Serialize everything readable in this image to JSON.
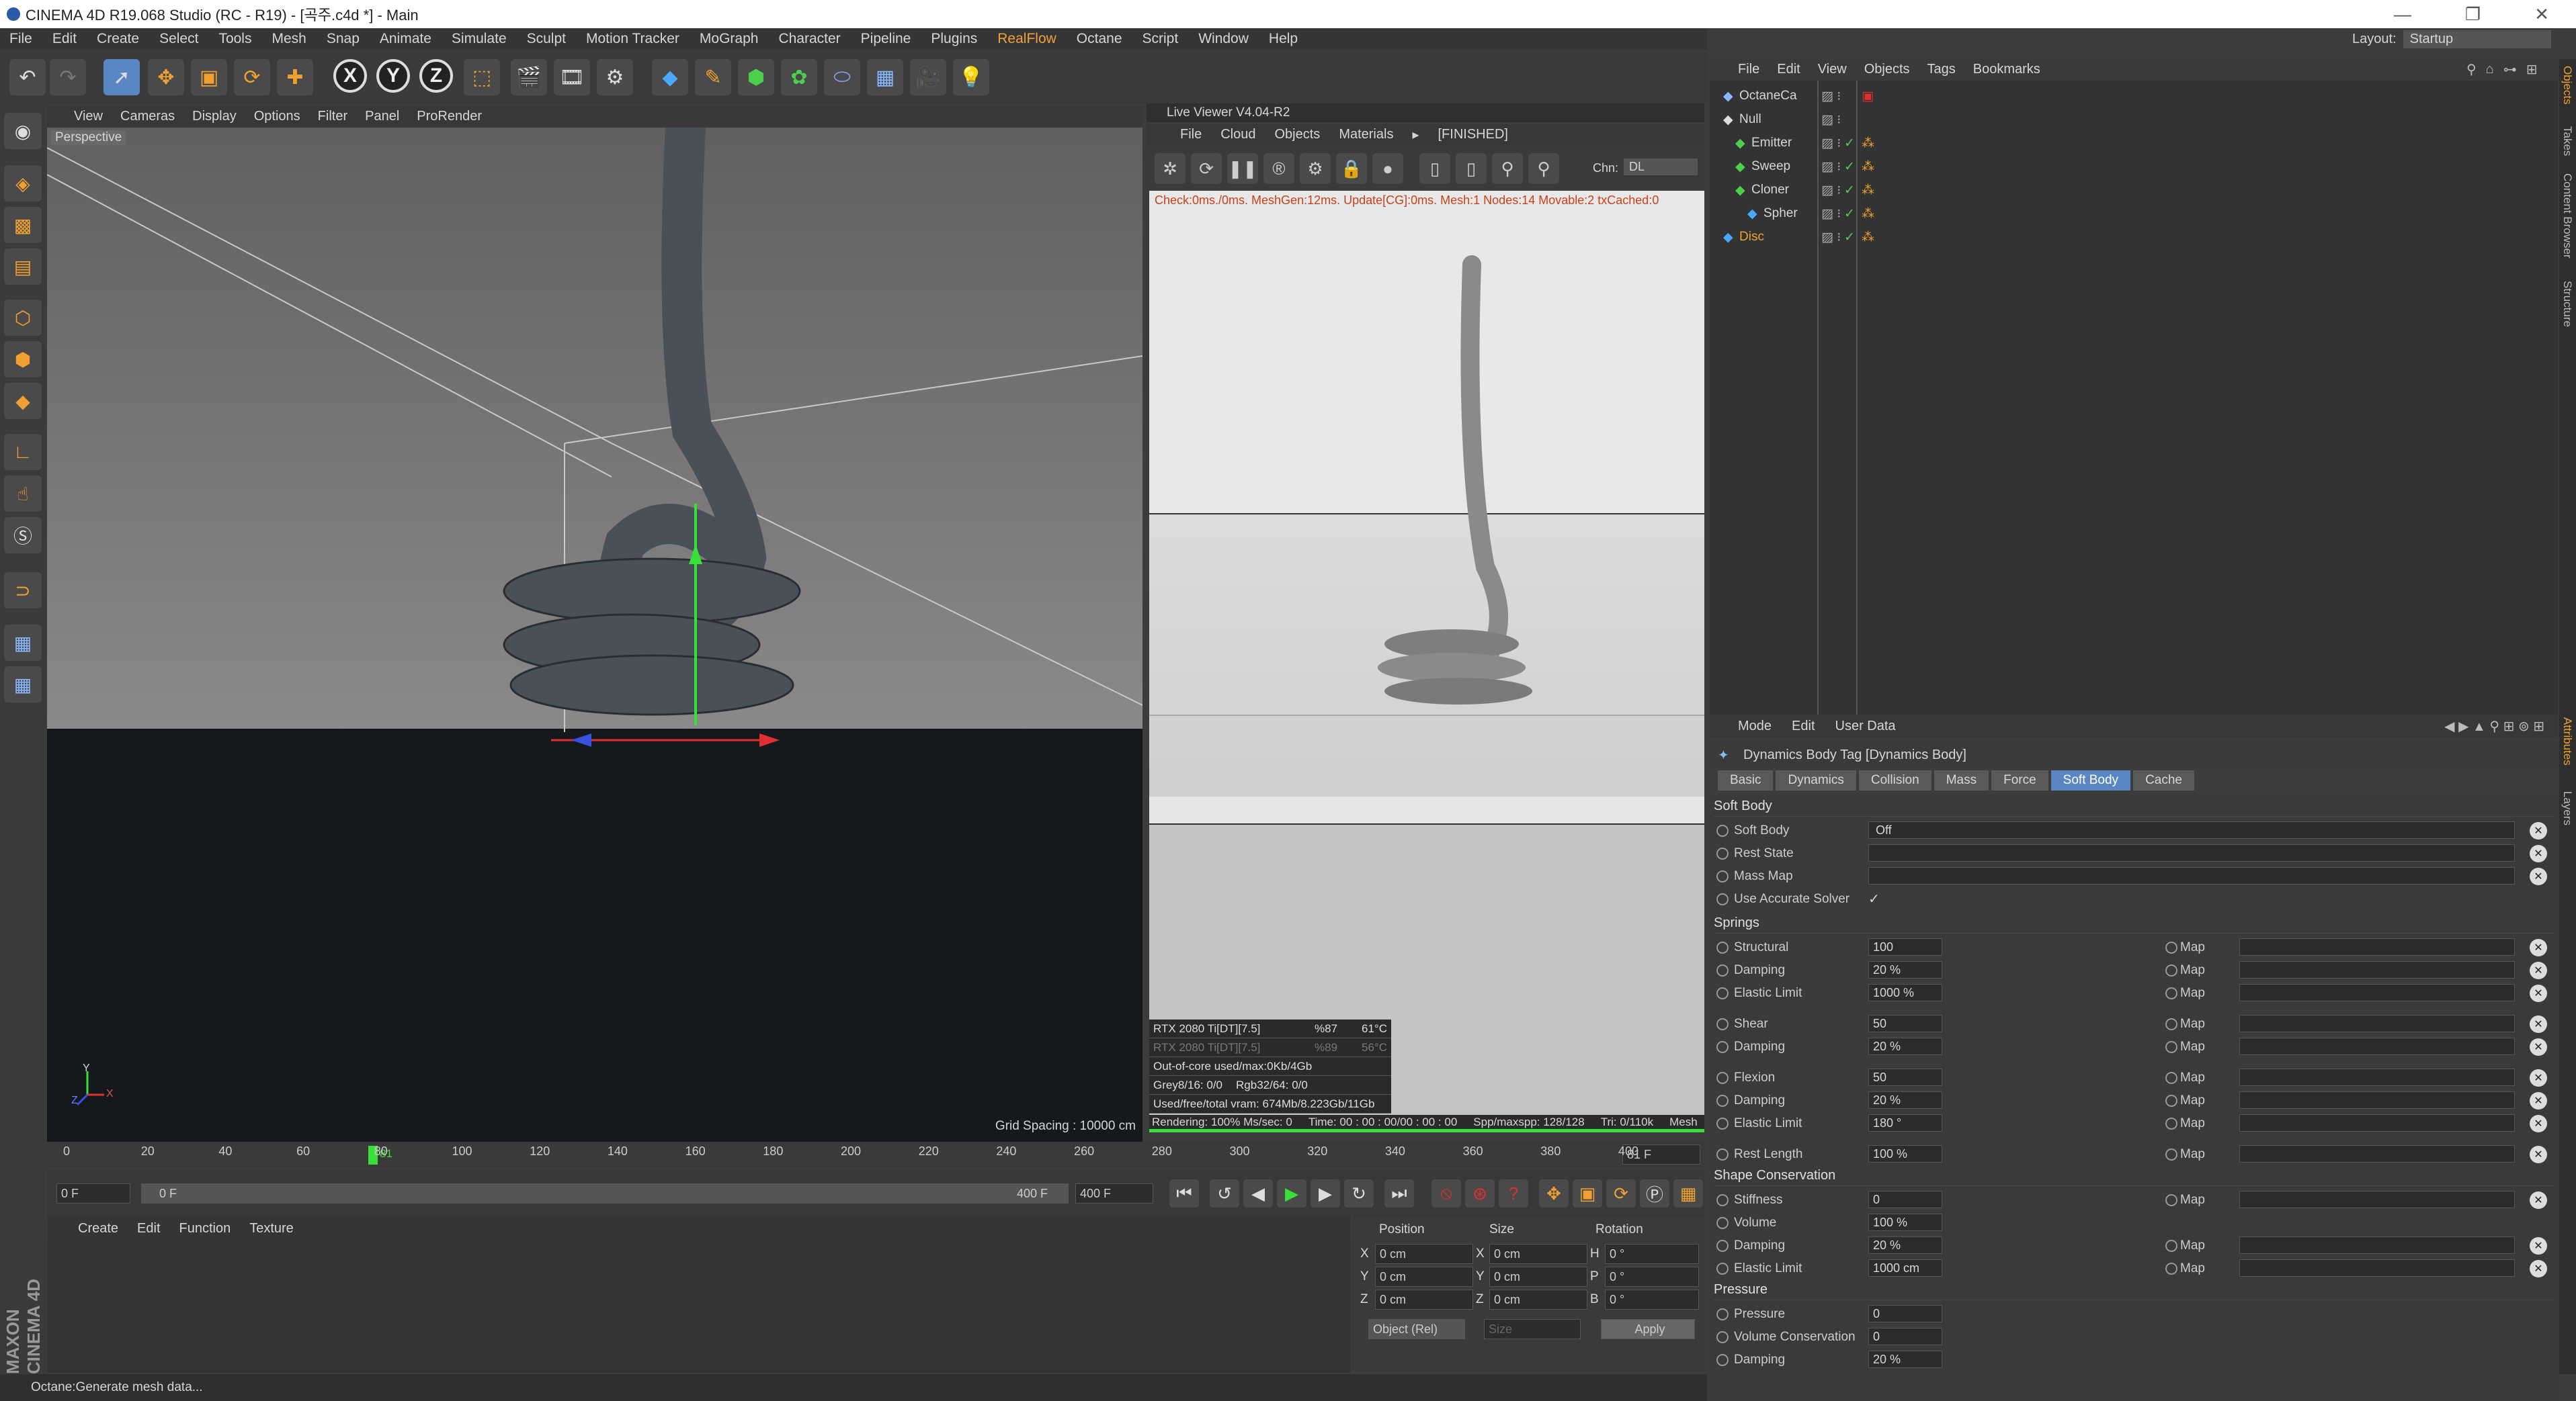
{
  "window": {
    "title": "CINEMA 4D R19.068 Studio (RC - R19) - [곡주.c4d *] - Main",
    "layout_label": "Layout:",
    "layout_value": "Startup"
  },
  "menu": [
    "File",
    "Edit",
    "Create",
    "Select",
    "Tools",
    "Mesh",
    "Snap",
    "Animate",
    "Simulate",
    "Sculpt",
    "Motion Tracker",
    "MoGraph",
    "Character",
    "Pipeline",
    "Plugins",
    "RealFlow",
    "Octane",
    "Script",
    "Window",
    "Help"
  ],
  "toolbar": {
    "axis_x": "X",
    "axis_y": "Y",
    "axis_z": "Z"
  },
  "viewport": {
    "menu": [
      "View",
      "Cameras",
      "Display",
      "Options",
      "Filter",
      "Panel",
      "ProRender"
    ],
    "label": "Perspective",
    "grid_spacing": "Grid Spacing : 10000 cm",
    "axis_y": "Y",
    "axis_x": "X",
    "axis_z": "Z"
  },
  "liveviewer": {
    "title": "Live Viewer V4.04-R2",
    "menu": [
      "File",
      "Cloud",
      "Objects",
      "Materials"
    ],
    "state": "[FINISHED]",
    "chn_label": "Chn:",
    "chn_value": "DL",
    "status": "Check:0ms./0ms. MeshGen:12ms. Update[CG]:0ms. Mesh:1 Nodes:14 Movable:2 txCached:0",
    "stats": [
      {
        "a": "RTX 2080 Ti[DT][7.5]",
        "b": "%87",
        "c": "61°C"
      },
      {
        "a": "RTX 2080 Ti[DT][7.5]",
        "b": "%89",
        "c": "56°C"
      }
    ],
    "ooc": "Out-of-core used/max:0Kb/4Gb",
    "grey": "Grey8/16: 0/0",
    "rgb": "Rgb32/64: 0/0",
    "vram": "Used/free/total vram: 674Mb/8.223Gb/11Gb",
    "render": "Rendering: 100% Ms/sec: 0",
    "time": "Time: 00 : 00 : 00/00 : 00 : 00",
    "spp": "Spp/maxspp: 128/128",
    "tri": "Tri: 0/110k",
    "mesh": "Mesh"
  },
  "timeline": {
    "ticks": [
      "0",
      "20",
      "40",
      "60",
      "80",
      "100",
      "120",
      "140",
      "160",
      "180",
      "200",
      "220",
      "240",
      "260",
      "280",
      "300",
      "320",
      "340",
      "360",
      "380",
      "400"
    ],
    "current": "81",
    "frame_field": "81 F",
    "start": "0 F",
    "start2": "0 F",
    "end_inner": "400 F",
    "end": "400 F"
  },
  "material": {
    "menu": [
      "Create",
      "Edit",
      "Function",
      "Texture"
    ]
  },
  "coords": {
    "h_position": "Position",
    "h_size": "Size",
    "h_rotation": "Rotation",
    "rows": [
      {
        "axis": "X",
        "pos": "0 cm",
        "saxis": "X",
        "size": "0 cm",
        "raxis": "H",
        "rot": "0 °"
      },
      {
        "axis": "Y",
        "pos": "0 cm",
        "saxis": "Y",
        "size": "0 cm",
        "raxis": "P",
        "rot": "0 °"
      },
      {
        "axis": "Z",
        "pos": "0 cm",
        "saxis": "Z",
        "size": "0 cm",
        "raxis": "B",
        "rot": "0 °"
      }
    ],
    "mode": "Object (Rel)",
    "size_mode": "Size",
    "apply": "Apply"
  },
  "status": "Octane:Generate mesh data...",
  "objects": {
    "menu": [
      "File",
      "Edit",
      "View",
      "Objects",
      "Tags",
      "Bookmarks"
    ],
    "items": [
      {
        "name": "OctaneCa",
        "indent": 0
      },
      {
        "name": "Null",
        "indent": 0
      },
      {
        "name": "Emitter",
        "indent": 1
      },
      {
        "name": "Sweep",
        "indent": 1
      },
      {
        "name": "Cloner",
        "indent": 1
      },
      {
        "name": "Spher",
        "indent": 2
      },
      {
        "name": "Disc",
        "indent": 0
      }
    ]
  },
  "attributes": {
    "menu": [
      "Mode",
      "Edit",
      "User Data"
    ],
    "title": "Dynamics Body Tag [Dynamics Body]",
    "tabs": [
      "Basic",
      "Dynamics",
      "Collision",
      "Mass",
      "Force",
      "Soft Body",
      "Cache"
    ],
    "active_tab": "Soft Body",
    "sec_softbody": "Soft Body",
    "sb_label": "Soft Body",
    "sb_value": "Off",
    "rest_state": "Rest State",
    "mass_map": "Mass Map",
    "accurate": "Use Accurate Solver",
    "check": "✓",
    "sec_springs": "Springs",
    "map": "Map",
    "springs": [
      {
        "label": "Structural",
        "value": "100"
      },
      {
        "label": "Damping",
        "value": "20 %"
      },
      {
        "label": "Elastic Limit",
        "value": "1000 %"
      },
      {
        "label": "Shear",
        "value": "50"
      },
      {
        "label": "Damping",
        "value": "20 %"
      },
      {
        "label": "Flexion",
        "value": "50"
      },
      {
        "label": "Damping",
        "value": "20 %"
      },
      {
        "label": "Elastic Limit",
        "value": "180 °"
      },
      {
        "label": "Rest Length",
        "value": "100 %"
      }
    ],
    "sec_shape": "Shape Conservation",
    "shape": [
      {
        "label": "Stiffness",
        "value": "0"
      },
      {
        "label": "Volume",
        "value": "100 %"
      },
      {
        "label": "Damping",
        "value": "20 %"
      },
      {
        "label": "Elastic Limit",
        "value": "1000 cm"
      }
    ],
    "sec_pressure": "Pressure",
    "pressure": [
      {
        "label": "Pressure",
        "value": "0"
      },
      {
        "label": "Volume Conservation",
        "value": "0"
      },
      {
        "label": "Damping",
        "value": "20 %"
      }
    ]
  },
  "sidetabs": [
    "Objects",
    "Takes",
    "Content Browser",
    "Structure",
    "Attributes",
    "Layers"
  ]
}
